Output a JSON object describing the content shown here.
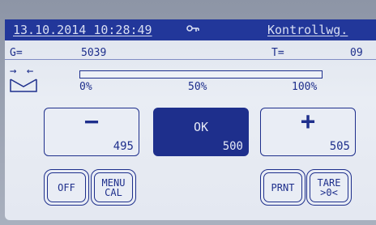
{
  "status_bar": {
    "datetime": "13.10.2014 10:28:49",
    "key_icon": "key-icon",
    "mode": "Kontrollwg."
  },
  "readouts": {
    "g_label": "G=",
    "g_value": "5039",
    "t_label": "T=",
    "t_value": "09"
  },
  "icons": {
    "arrows": "→ ←",
    "envelope": "envelope-icon"
  },
  "progress": {
    "fraction": 0.0,
    "ticks": [
      "0%",
      "50%",
      "100%"
    ]
  },
  "buttons": {
    "minus": {
      "symbol": "−",
      "value": "495"
    },
    "ok": {
      "symbol": "OK",
      "value": "500"
    },
    "plus": {
      "symbol": "+",
      "value": "505"
    }
  },
  "soft_keys": {
    "off": "OFF",
    "menu_line1": "MENU",
    "menu_line2": "CAL",
    "prnt": "PRNT",
    "tare_line1": "TARE",
    "tare_line2": ">0<"
  },
  "colors": {
    "accent": "#1e2f8c",
    "status_bar": "#22379a",
    "screen": "#e4e8f1"
  }
}
